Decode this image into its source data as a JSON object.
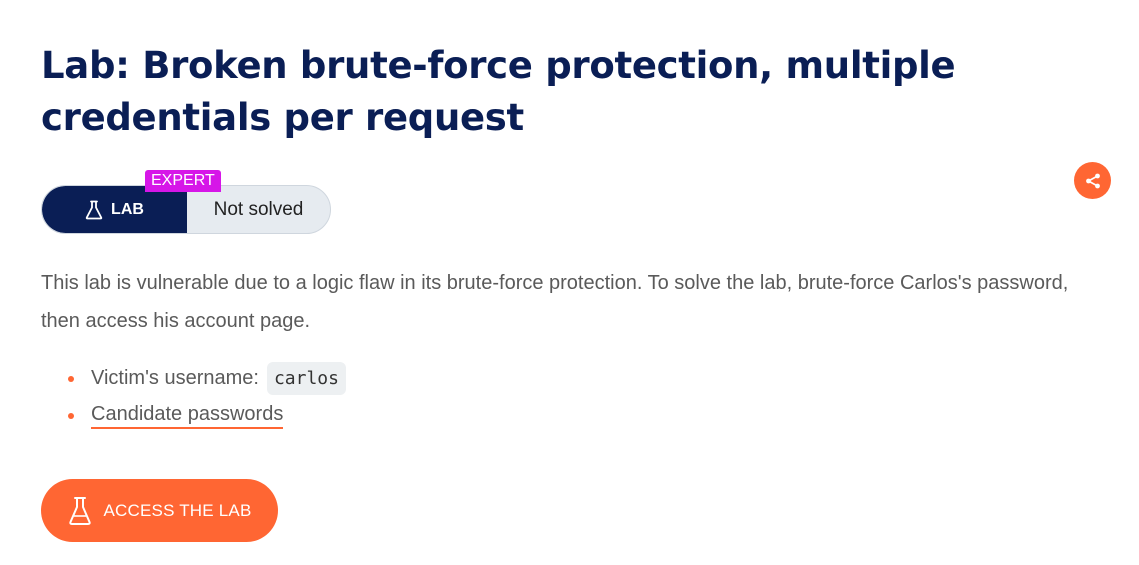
{
  "title": "Lab: Broken brute-force protection, multiple credentials per request",
  "lab_status": {
    "lab_label": "LAB",
    "status": "Not solved",
    "level": "EXPERT",
    "level_color": "#d616e8"
  },
  "share": {
    "icon": "share-icon"
  },
  "description": "This lab is vulnerable due to a logic flaw in its brute-force protection. To solve the lab, brute-force Carlos's password, then access his account page.",
  "details": {
    "username_label": "Victim's username:",
    "username_value": "carlos",
    "passwords_link": "Candidate passwords"
  },
  "access_button": {
    "label": "ACCESS THE LAB",
    "icon": "flask-icon"
  },
  "colors": {
    "accent": "#ff6633",
    "title": "#0a1e55",
    "lab_pill": "#0a1e55"
  }
}
